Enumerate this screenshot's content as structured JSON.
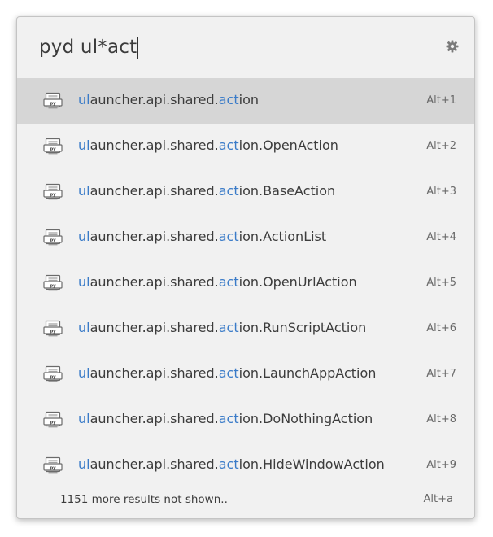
{
  "query": {
    "value": "pyd ul*act",
    "prefs_icon": "gear-icon"
  },
  "results": [
    {
      "prefix_hl": "ul",
      "mid": "auncher.api.shared.",
      "mid_hl": "act",
      "suffix": "ion",
      "shortcut": "Alt+1",
      "selected": true,
      "icon": "python-file-icon"
    },
    {
      "prefix_hl": "ul",
      "mid": "auncher.api.shared.",
      "mid_hl": "act",
      "suffix": "ion.OpenAction",
      "shortcut": "Alt+2",
      "selected": false,
      "icon": "python-file-icon"
    },
    {
      "prefix_hl": "ul",
      "mid": "auncher.api.shared.",
      "mid_hl": "act",
      "suffix": "ion.BaseAction",
      "shortcut": "Alt+3",
      "selected": false,
      "icon": "python-file-icon"
    },
    {
      "prefix_hl": "ul",
      "mid": "auncher.api.shared.",
      "mid_hl": "act",
      "suffix": "ion.ActionList",
      "shortcut": "Alt+4",
      "selected": false,
      "icon": "python-file-icon"
    },
    {
      "prefix_hl": "ul",
      "mid": "auncher.api.shared.",
      "mid_hl": "act",
      "suffix": "ion.OpenUrlAction",
      "shortcut": "Alt+5",
      "selected": false,
      "icon": "python-file-icon"
    },
    {
      "prefix_hl": "ul",
      "mid": "auncher.api.shared.",
      "mid_hl": "act",
      "suffix": "ion.RunScriptAction",
      "shortcut": "Alt+6",
      "selected": false,
      "icon": "python-file-icon"
    },
    {
      "prefix_hl": "ul",
      "mid": "auncher.api.shared.",
      "mid_hl": "act",
      "suffix": "ion.LaunchAppAction",
      "shortcut": "Alt+7",
      "selected": false,
      "icon": "python-file-icon"
    },
    {
      "prefix_hl": "ul",
      "mid": "auncher.api.shared.",
      "mid_hl": "act",
      "suffix": "ion.DoNothingAction",
      "shortcut": "Alt+8",
      "selected": false,
      "icon": "python-file-icon"
    },
    {
      "prefix_hl": "ul",
      "mid": "auncher.api.shared.",
      "mid_hl": "act",
      "suffix": "ion.HideWindowAction",
      "shortcut": "Alt+9",
      "selected": false,
      "icon": "python-file-icon"
    }
  ],
  "footer": {
    "more_text": "1151 more results not shown..",
    "more_shortcut": "Alt+a"
  },
  "colors": {
    "highlight": "#3a7bc8",
    "selected_row": "#d6d6d6",
    "background": "#f1f1f1"
  }
}
